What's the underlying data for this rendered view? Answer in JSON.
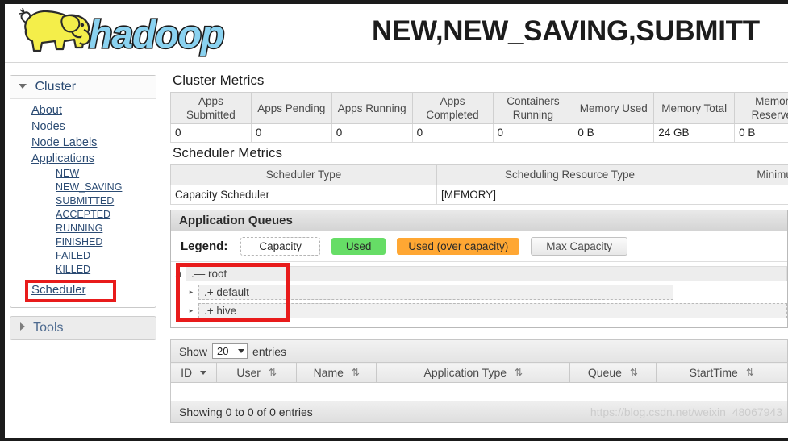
{
  "header": {
    "logo_text": "hadoop",
    "logo_alt": "hadoop-elephant-logo",
    "title": "NEW,NEW_SAVING,SUBMITT"
  },
  "sidebar": {
    "cluster": {
      "label": "Cluster",
      "items": [
        {
          "label": "About",
          "name": "sidebar-item-about"
        },
        {
          "label": "Nodes",
          "name": "sidebar-item-nodes"
        },
        {
          "label": "Node Labels",
          "name": "sidebar-item-node-labels"
        },
        {
          "label": "Applications",
          "name": "sidebar-item-applications"
        }
      ],
      "app_states": [
        "NEW",
        "NEW_SAVING",
        "SUBMITTED",
        "ACCEPTED",
        "RUNNING",
        "FINISHED",
        "FAILED",
        "KILLED"
      ],
      "scheduler_label": "Scheduler"
    },
    "tools": {
      "label": "Tools"
    }
  },
  "main": {
    "cluster_metrics": {
      "title": "Cluster Metrics",
      "columns": [
        "Apps Submitted",
        "Apps Pending",
        "Apps Running",
        "Apps Completed",
        "Containers Running",
        "Memory Used",
        "Memory Total",
        "Memory Reserved"
      ],
      "values": [
        "0",
        "0",
        "0",
        "0",
        "0",
        "0 B",
        "24 GB",
        "0 B"
      ]
    },
    "scheduler_metrics": {
      "title": "Scheduler Metrics",
      "columns": [
        "Scheduler Type",
        "Scheduling Resource Type",
        "Minimum Allocation"
      ],
      "values": [
        "Capacity Scheduler",
        "[MEMORY]",
        ""
      ]
    },
    "application_queues": {
      "title": "Application Queues",
      "legend_label": "Legend:",
      "legend": [
        {
          "label": "Capacity",
          "kind": "capacity"
        },
        {
          "label": "Used",
          "kind": "used"
        },
        {
          "label": "Used (over capacity)",
          "kind": "over"
        },
        {
          "label": "Max Capacity",
          "kind": "max"
        }
      ],
      "queues": [
        {
          "label": "root",
          "marker": ".—",
          "arrow": "◢",
          "depth": 0
        },
        {
          "label": "default",
          "marker": ".+",
          "arrow": "▸",
          "depth": 1
        },
        {
          "label": "hive",
          "marker": ".+",
          "arrow": "▸",
          "depth": 1
        }
      ]
    },
    "apps_table": {
      "show_label": "Show",
      "entries_label": "entries",
      "page_size": "20",
      "columns": [
        "ID",
        "User",
        "Name",
        "Application Type",
        "Queue",
        "StartTime"
      ],
      "rows": [],
      "footer_text": "Showing 0 to 0 of 0 entries"
    },
    "watermark": "https://blog.csdn.net/weixin_48067943"
  },
  "colors": {
    "used_green": "#66dd66",
    "over_orange": "#ffa733",
    "highlight_red": "#e81b1b",
    "link_blue": "#2b4b73",
    "logo_blue": "#8ad2f0",
    "logo_yellow": "#f4ee4a"
  }
}
